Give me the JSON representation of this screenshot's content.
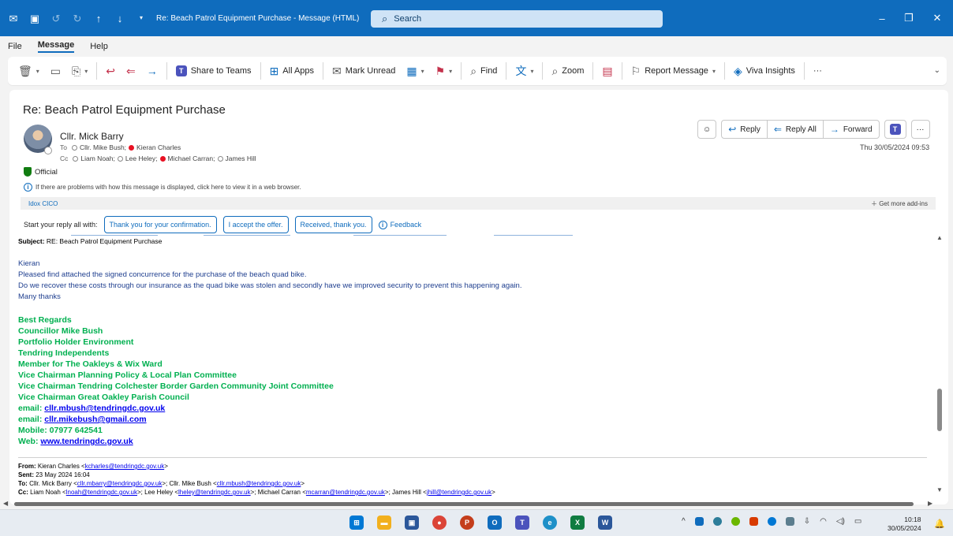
{
  "window": {
    "title": "Re: Beach Patrol Equipment Purchase  -  Message (HTML)",
    "search_placeholder": "Search"
  },
  "menu": [
    "File",
    "Message",
    "Help"
  ],
  "ribbon": {
    "share_to_teams": "Share to Teams",
    "all_apps": "All Apps",
    "mark_unread": "Mark Unread",
    "find": "Find",
    "zoom": "Zoom",
    "report_message": "Report Message",
    "viva_insights": "Viva Insights",
    "more": "···"
  },
  "message": {
    "subject_title": "Re: Beach Patrol Equipment Purchase",
    "sender": "Cllr. Mick Barry",
    "to_label": "To",
    "to": [
      "Cllr. Mike Bush;",
      "Kieran Charles"
    ],
    "cc_label": "Cc",
    "cc": [
      "Liam Noah;",
      "Lee Heley;",
      "Michael Carran;",
      "James Hill"
    ],
    "actions": {
      "reply": "Reply",
      "reply_all": "Reply All",
      "forward": "Forward",
      "more": "···"
    },
    "date": "Thu 30/05/2024 09:53",
    "classification": "Official",
    "info": "If there are problems with how this message is displayed, click here to view it in a web browser.",
    "addin": "Idox CICO",
    "get_addins": "Get more add-ins"
  },
  "reply_suggestions": {
    "label": "Start your reply all with:",
    "chips": [
      "Thank you for your confirmation.",
      "I accept the offer.",
      "Received, thank you."
    ],
    "feedback": "Feedback"
  },
  "body": {
    "subject_label": "Subject:",
    "subject_value": "RE: Beach Patrol Equipment Purchase",
    "lines": [
      "Kieran",
      "Pleased find attached the signed concurrence for the purchase of the beach quad bike.",
      "Do we recover these costs through our insurance as the quad bike was stolen and secondly have we improved security to prevent this happening again.",
      "Many thanks"
    ],
    "signature": [
      "Best Regards",
      "Councillor Mike Bush",
      "Portfolio Holder Environment",
      "Tendring Independents",
      "Member for The Oakleys & Wix Ward",
      "Vice Chairman Planning Policy & Local Plan Committee",
      "Vice Chairman Tendring Colchester Border Garden Community Joint Committee",
      "Vice Chairman Great Oakley Parish Council"
    ],
    "email1_label": "email:",
    "email1": "cllr.mbush@tendringdc.gov.uk",
    "email2_label": "email:",
    "email2": "cllr.mikebush@gmail.com",
    "mobile": "Mobile: 07977 642541",
    "web_label": "Web:",
    "web": "www.tendringdc.gov.uk",
    "from_label": "From:",
    "from_name": "Kieran Charles <",
    "from_email": "kcharles@tendringdc.gov.uk",
    "sent_label": "Sent:",
    "sent_value": "23 May 2024 16:04",
    "to_label": "To:",
    "to_1": "Cllr. Mick Barry <",
    "to_1_email": "cllr.mbarry@tendringdc.gov.uk",
    "to_2": ">; Cllr. Mike Bush <",
    "to_2_email": "cllr.mbush@tendringdc.gov.uk",
    "cc_label": "Cc:",
    "cc_1": "Liam Noah <",
    "cc_1_email": "lnoah@tendringdc.gov.uk",
    "cc_2": ">; Lee Heley <",
    "cc_2_email": "lheley@tendringdc.gov.uk",
    "cc_3": ">; Michael Carran <",
    "cc_3_email": "mcarran@tendringdc.gov.uk",
    "cc_4": ">; James Hill <",
    "cc_4_email": "jhill@tendringdc.gov.uk"
  },
  "taskbar": {
    "time": "10:18",
    "date": "30/05/2024"
  }
}
